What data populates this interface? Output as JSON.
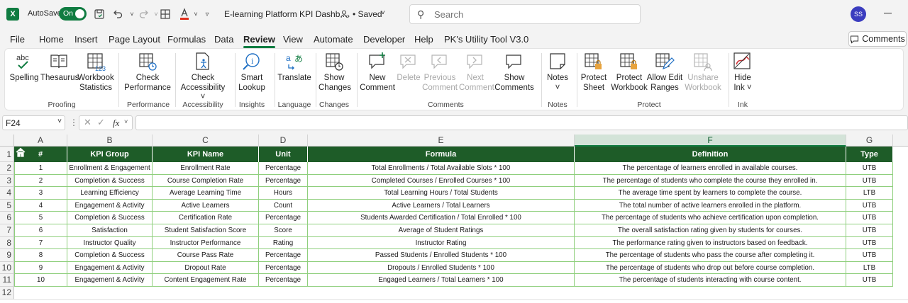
{
  "titlebar": {
    "app_icon": "excel-logo",
    "app_letter": "X",
    "autosave_label": "AutoSave",
    "autosave_state": "On",
    "document_title": "E-learning Platform KPI Dashb...",
    "saved_status": "• Saved",
    "search_placeholder": "Search",
    "user_initials": "SS"
  },
  "menu": {
    "tabs": [
      "File",
      "Home",
      "Insert",
      "Page Layout",
      "Formulas",
      "Data",
      "Review",
      "View",
      "Automate",
      "Developer",
      "Help",
      "PK's Utility Tool V3.0"
    ],
    "active_tab": "Review",
    "comments_button": "Comments"
  },
  "ribbon": {
    "groups": {
      "proofing": "Proofing",
      "performance": "Performance",
      "accessibility": "Accessibility",
      "insights": "Insights",
      "language": "Language",
      "changes": "Changes",
      "comments": "Comments",
      "notes": "Notes",
      "protect": "Protect",
      "ink": "Ink"
    },
    "buttons": {
      "spelling": "Spelling",
      "thesaurus": "Thesaurus",
      "workbook_statistics_1": "Workbook",
      "workbook_statistics_2": "Statistics",
      "check_performance_1": "Check",
      "check_performance_2": "Performance",
      "check_accessibility_1": "Check",
      "check_accessibility_2": "Accessibility ˅",
      "smart_lookup_1": "Smart",
      "smart_lookup_2": "Lookup",
      "translate": "Translate",
      "show_changes_1": "Show",
      "show_changes_2": "Changes",
      "new_comment_1": "New",
      "new_comment_2": "Comment",
      "delete": "Delete",
      "previous_comment_1": "Previous",
      "previous_comment_2": "Comment",
      "next_comment_1": "Next",
      "next_comment_2": "Comment",
      "show_comments_1": "Show",
      "show_comments_2": "Comments",
      "notes_1": "Notes",
      "notes_2": "˅",
      "protect_sheet_1": "Protect",
      "protect_sheet_2": "Sheet",
      "protect_workbook_1": "Protect",
      "protect_workbook_2": "Workbook",
      "allow_edit_ranges_1": "Allow Edit",
      "allow_edit_ranges_2": "Ranges",
      "unshare_workbook_1": "Unshare",
      "unshare_workbook_2": "Workbook",
      "hide_ink_1": "Hide",
      "hide_ink_2": "Ink ˅"
    }
  },
  "formula_bar": {
    "name_box": "F24",
    "fx_label": "fx",
    "formula": ""
  },
  "sheet": {
    "columns": [
      "A",
      "B",
      "C",
      "D",
      "E",
      "F",
      "G"
    ],
    "selected_column": "F",
    "row_numbers": [
      "1",
      "2",
      "3",
      "4",
      "5",
      "6",
      "7",
      "8",
      "9",
      "10",
      "11",
      "12"
    ],
    "headers": [
      "#",
      "KPI Group",
      "KPI Name",
      "Unit",
      "Formula",
      "Definition",
      "Type"
    ],
    "rows": [
      [
        "1",
        "Enrollment & Engagement",
        "Enrollment Rate",
        "Percentage",
        "Total Enrollments / Total Available Slots * 100",
        "The percentage of learners enrolled in available courses.",
        "UTB"
      ],
      [
        "2",
        "Completion & Success",
        "Course Completion Rate",
        "Percentage",
        "Completed Courses / Enrolled Courses * 100",
        "The percentage of students who complete the course they enrolled in.",
        "UTB"
      ],
      [
        "3",
        "Learning Efficiency",
        "Average Learning Time",
        "Hours",
        "Total Learning Hours / Total Students",
        "The average time spent by learners to complete the course.",
        "LTB"
      ],
      [
        "4",
        "Engagement & Activity",
        "Active Learners",
        "Count",
        "Active Learners / Total Learners",
        "The total number of active learners enrolled in the platform.",
        "UTB"
      ],
      [
        "5",
        "Completion & Success",
        "Certification Rate",
        "Percentage",
        "Students Awarded Certification / Total Enrolled * 100",
        "The percentage of students who achieve certification upon completion.",
        "UTB"
      ],
      [
        "6",
        "Satisfaction",
        "Student Satisfaction Score",
        "Score",
        "Average of Student Ratings",
        "The overall satisfaction rating given by students for courses.",
        "UTB"
      ],
      [
        "7",
        "Instructor Quality",
        "Instructor Performance",
        "Rating",
        "Instructor Rating",
        "The performance rating given to instructors based on feedback.",
        "UTB"
      ],
      [
        "8",
        "Completion & Success",
        "Course Pass Rate",
        "Percentage",
        "Passed Students / Enrolled Students * 100",
        "The percentage of students who pass the course after completing it.",
        "UTB"
      ],
      [
        "9",
        "Engagement & Activity",
        "Dropout Rate",
        "Percentage",
        "Dropouts / Enrolled Students * 100",
        "The percentage of students who drop out before course completion.",
        "LTB"
      ],
      [
        "10",
        "Engagement & Activity",
        "Content Engagement Rate",
        "Percentage",
        "Engaged Learners / Total Learners * 100",
        "The percentage of students interacting with course content.",
        "UTB"
      ]
    ]
  },
  "colors": {
    "accent": "#107c41",
    "header_fill": "#1e5c28",
    "cell_border": "#8fcf7d"
  }
}
